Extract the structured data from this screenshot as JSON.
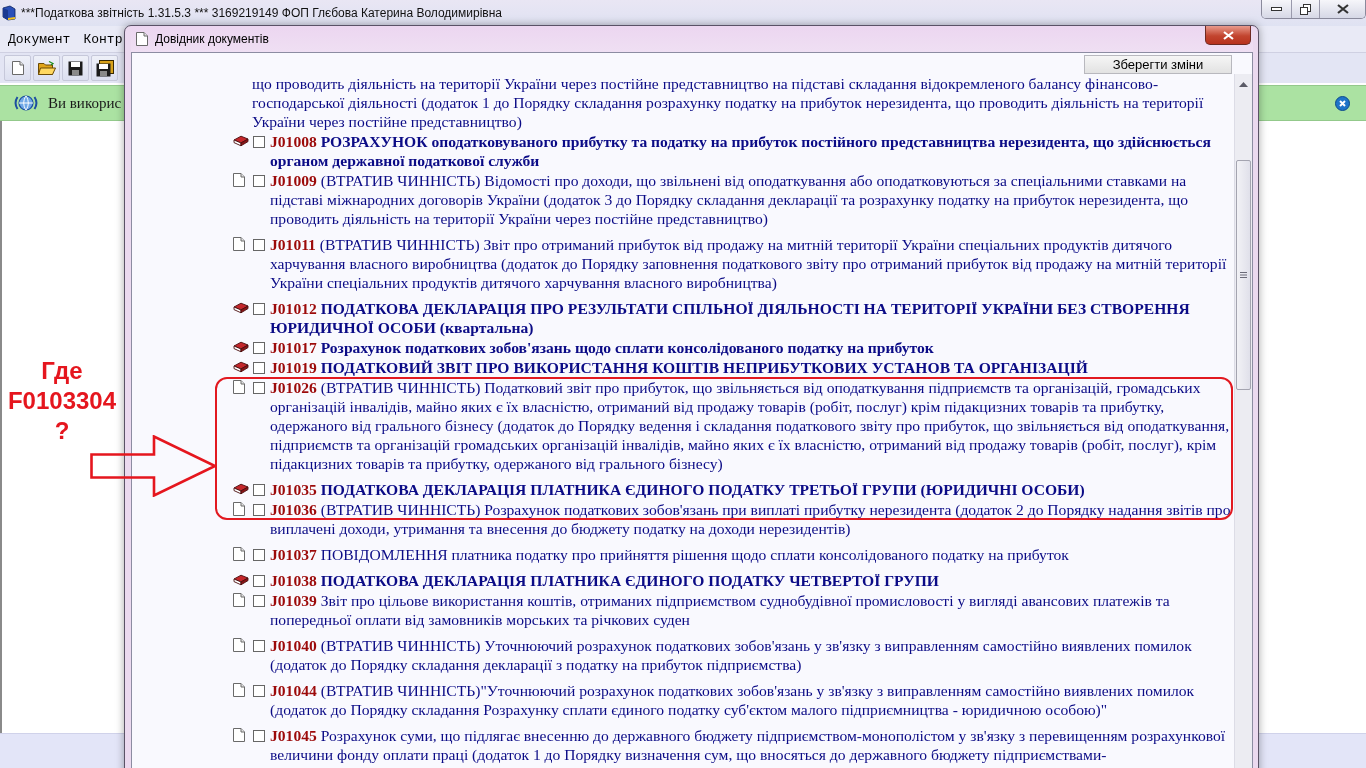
{
  "app_window": {
    "title": "***Податкова звітність 1.31.5.3 *** 3169219149 ФОП Глєбова Катерина Володимирівна",
    "menu": [
      "Документ",
      "Контр"
    ]
  },
  "banner": {
    "text": "Ви викорис"
  },
  "dialog": {
    "title": "Довідник документів",
    "save_button": "Зберегти зміни",
    "items": [
      {
        "kind": "continuation",
        "highlighted": false,
        "text": "що проводить діяльність на території України через постійне представництво на підставі складання відокремленого балансу фінансово-господарської діяльності (додаток 1 до Порядку складання розрахунку податку на прибуток нерезидента, що проводить діяльність на території України через постійне представництво)"
      },
      {
        "kind": "book",
        "checked": false,
        "highlighted": false,
        "code": "J01008",
        "text": "РОЗРАХУНОК оподатковуваного прибутку та податку на прибуток постійного представництва нерезидента, що здійснюється органом державної податкової служби"
      },
      {
        "kind": "document",
        "checked": false,
        "highlighted": false,
        "code": "J01009",
        "text": "(ВТРАТИВ ЧИННІСТЬ) Відомості про доходи, що звільнені від оподаткування або оподатковуються за спеціальними ставками на підставі міжнародних договорів України (додаток 3 до Порядку складання декларації та розрахунку податку на прибуток нерезидента, що проводить діяльність на території України через постійне представництво)"
      },
      {
        "kind": "document",
        "checked": false,
        "highlighted": false,
        "code": "J01011",
        "text": "(ВТРАТИВ ЧИННІСТЬ) Звіт про отриманий прибуток від продажу на митній території України спеціальних продуктів дитячого харчування власного виробництва (додаток до Порядку заповнення податкового звіту про отриманий прибуток від продажу на митній території України спеціальних продуктів дитячого харчування власного виробництва)"
      },
      {
        "kind": "book",
        "checked": false,
        "highlighted": false,
        "code": "J01012",
        "text": "ПОДАТКОВА ДЕКЛАРАЦІЯ ПРО РЕЗУЛЬТАТИ СПІЛЬНОЇ ДІЯЛЬНОСТІ НА ТЕРИТОРІЇ УКРАЇНИ БЕЗ СТВОРЕННЯ ЮРИДИЧНОЇ ОСОБИ (квартальна)"
      },
      {
        "kind": "book",
        "checked": false,
        "highlighted": false,
        "code": "J01017",
        "text": "Розрахунок податкових зобов'язань щодо сплати консолідованого податку на прибуток"
      },
      {
        "kind": "book",
        "checked": false,
        "highlighted": false,
        "code": "J01019",
        "text": "ПОДАТКОВИЙ ЗВІТ ПРО ВИКОРИСТАННЯ КОШТІВ НЕПРИБУТКОВИХ УСТАНОВ ТА ОРГАНІЗАЦІЙ"
      },
      {
        "kind": "document",
        "checked": false,
        "highlighted": true,
        "code": "J01026",
        "text": "(ВТРАТИВ ЧИННІСТЬ) Податковий звіт про прибуток, що звільняється від оподаткування підприємств та організацій, громадських організацій інвалідів, майно яких є їх власністю, отриманий від продажу товарів (робіт, послуг) крім підакцизних товарів та прибутку, одержаного від грального бізнесу (додаток до Порядку ведення і складання податкового звіту про прибуток, що звільняється від оподаткування, підприємств та організацій громадських організацій інвалідів, майно яких є їх власністю, отриманий від продажу товарів (робіт, послуг), крім підакцизних товарів та прибутку, одержаного від грального бізнесу)"
      },
      {
        "kind": "book",
        "checked": false,
        "highlighted": true,
        "code": "J01035",
        "text": "ПОДАТКОВА ДЕКЛАРАЦІЯ ПЛАТНИКА ЄДИНОГО ПОДАТКУ ТРЕТЬОЇ ГРУПИ (ЮРИДИЧНІ ОСОБИ)"
      },
      {
        "kind": "document",
        "checked": false,
        "highlighted": true,
        "code": "J01036",
        "text": "(ВТРАТИВ ЧИННІСТЬ) Розрахунок податкових зобов'язань при виплаті прибутку нерезидента (додаток 2 до Порядку надання звітів про виплачені доходи, утримання та внесення до бюджету податку на доходи нерезидентів)"
      },
      {
        "kind": "document",
        "checked": false,
        "highlighted": false,
        "code": "J01037",
        "text": "ПОВІДОМЛЕННЯ платника податку про прийняття рішення щодо сплати консолідованого податку на прибуток"
      },
      {
        "kind": "book",
        "checked": false,
        "highlighted": false,
        "code": "J01038",
        "text": "ПОДАТКОВА ДЕКЛАРАЦІЯ ПЛАТНИКА ЄДИНОГО ПОДАТКУ ЧЕТВЕРТОЇ ГРУПИ"
      },
      {
        "kind": "document",
        "checked": false,
        "highlighted": false,
        "code": "J01039",
        "text": "Звіт про цільове використання коштів, отриманих підприємством суднобудівної промисловості у вигляді авансових платежів та попередньої оплати від замовників морських та річкових суден"
      },
      {
        "kind": "document",
        "checked": false,
        "highlighted": false,
        "code": "J01040",
        "text": "(ВТРАТИВ ЧИННІСТЬ) Уточнюючий розрахунок податкових зобов'язань у зв'язку з виправленням самостійно виявлених помилок (додаток до Порядку складання декларації з податку на прибуток підприємства)"
      },
      {
        "kind": "document",
        "checked": false,
        "highlighted": false,
        "code": "J01044",
        "text": "(ВТРАТИВ ЧИННІСТЬ)\"Уточнюючий розрахунок податкових зобов'язань у зв'язку з виправленням самостійно виявлених помилок (додаток до Порядку складання Розрахунку сплати єдиного податку суб'єктом малого підприємництва - юридичною особою)\""
      },
      {
        "kind": "document",
        "checked": false,
        "highlighted": false,
        "code": "J01045",
        "text": "Розрахунок суми, що підлягає внесенню до державного бюджету підприємством-монополістом у зв'язку з перевищенням розрахункової величини фонду оплати праці (додаток 1 до Порядку визначення сум, що вносяться до державного бюджету підприємствами-"
      }
    ]
  },
  "annotation": {
    "note_lines": [
      "Где",
      "F0103304",
      "?"
    ]
  }
}
